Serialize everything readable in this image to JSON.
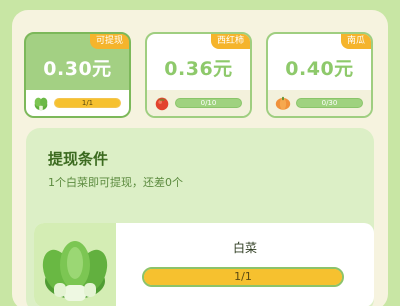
{
  "rewards": [
    {
      "tag": "可提现",
      "amount": "0.30元",
      "progress_text": "1/1",
      "progress": 1.0,
      "icon": "cabbage-icon",
      "state": "active"
    },
    {
      "tag": "西红柿",
      "amount": "0.36元",
      "progress_text": "0/10",
      "progress": 0.0,
      "icon": "tomato-icon",
      "state": "locked"
    },
    {
      "tag": "南瓜",
      "amount": "0.40元",
      "progress_text": "0/30",
      "progress": 0.0,
      "icon": "pumpkin-icon",
      "state": "locked"
    }
  ],
  "condition": {
    "title": "提现条件",
    "description": "1个白菜即可提现，还差0个",
    "task": {
      "name": "白菜",
      "progress_text": "1/1",
      "progress": 1.0,
      "icon": "cabbage-icon"
    }
  },
  "colors": {
    "background": "#c8e6a4",
    "panel": "#f6f3df",
    "accent_green": "#8ec96b",
    "tag_orange": "#f5b42c",
    "bar_yellow": "#f6c12f"
  }
}
